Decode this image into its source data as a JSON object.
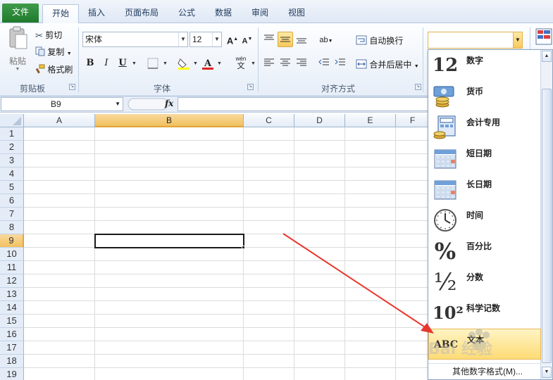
{
  "tabs": [
    {
      "label": "文件"
    },
    {
      "label": "开始"
    },
    {
      "label": "插入"
    },
    {
      "label": "页面布局"
    },
    {
      "label": "公式"
    },
    {
      "label": "数据"
    },
    {
      "label": "审阅"
    },
    {
      "label": "视图"
    }
  ],
  "clipboard": {
    "paste": "粘贴",
    "cut": "剪切",
    "copy": "复制",
    "format_painter": "格式刷",
    "group": "剪贴板"
  },
  "font": {
    "name": "宋体",
    "size": "12",
    "grow": "A",
    "shrink": "A",
    "bold": "B",
    "italic": "I",
    "underline": "U",
    "color_letter": "A",
    "phonetic": "wén",
    "group": "字体"
  },
  "alignment": {
    "wrap_text": "自动换行",
    "merge_center": "合并后居中",
    "group": "对齐方式"
  },
  "formula_bar": {
    "name_box": "B9",
    "fx": "fx",
    "content": ""
  },
  "grid": {
    "columns": [
      "A",
      "B",
      "C",
      "D",
      "E",
      "F"
    ],
    "selected_column": "B",
    "rows": [
      "1",
      "2",
      "3",
      "4",
      "5",
      "6",
      "7",
      "8",
      "9",
      "10",
      "11",
      "12",
      "13",
      "14",
      "15",
      "16",
      "17",
      "18",
      "19"
    ],
    "selected_row": "9",
    "active_cell": "B9"
  },
  "number_format": {
    "current_value": "",
    "items": [
      {
        "label": "数字",
        "glyph": "12",
        "icon": "number-icon"
      },
      {
        "label": "货币",
        "glyph": "",
        "icon": "currency-icon"
      },
      {
        "label": "会计专用",
        "glyph": "",
        "icon": "accounting-icon"
      },
      {
        "label": "短日期",
        "glyph": "",
        "icon": "short-date-icon"
      },
      {
        "label": "长日期",
        "glyph": "",
        "icon": "long-date-icon"
      },
      {
        "label": "时间",
        "glyph": "",
        "icon": "clock-icon"
      },
      {
        "label": "百分比",
        "glyph": "%",
        "icon": "percent-icon"
      },
      {
        "label": "分数",
        "glyph": "½",
        "icon": "fraction-icon"
      },
      {
        "label": "科学记数",
        "glyph": "10²",
        "icon": "scientific-icon"
      },
      {
        "label": "文本",
        "glyph": "ABC",
        "icon": "text-icon"
      }
    ],
    "more_formats": "其他数字格式(M)...",
    "highlighted": "文本"
  },
  "watermark": {
    "text": "Bai 经验"
  },
  "colors": {
    "accent": "#1f7a2c",
    "highlight": "#f8c95c",
    "arrow": "#e8372e"
  }
}
